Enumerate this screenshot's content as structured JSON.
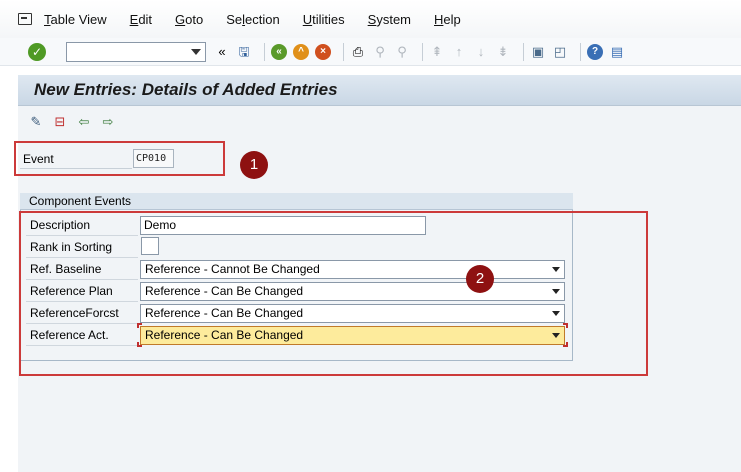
{
  "menu": {
    "items": [
      {
        "label": "Table View",
        "underline": "T"
      },
      {
        "label": "Edit",
        "underline": "E"
      },
      {
        "label": "Goto",
        "underline": "G"
      },
      {
        "label": "Selection",
        "underline": "l"
      },
      {
        "label": "Utilities",
        "underline": "U"
      },
      {
        "label": "System",
        "underline": "S"
      },
      {
        "label": "Help",
        "underline": "H"
      }
    ]
  },
  "window": {
    "title": "New Entries: Details of Added Entries"
  },
  "event": {
    "label": "Event",
    "value": "CP010"
  },
  "component_events": {
    "title": "Component Events",
    "fields": {
      "description": {
        "label": "Description",
        "value": "Demo"
      },
      "rank_in_sorting": {
        "label": "Rank in Sorting",
        "value": ""
      },
      "ref_baseline": {
        "label": "Ref. Baseline",
        "value": "Reference - Cannot Be Changed"
      },
      "reference_plan": {
        "label": "Reference Plan",
        "value": "Reference - Can Be Changed"
      },
      "reference_forcst": {
        "label": "ReferenceForcst",
        "value": "Reference - Can Be Changed"
      },
      "reference_act": {
        "label": "Reference Act.",
        "value": "Reference - Can Be Changed"
      }
    }
  },
  "annotations": {
    "badge1": "1",
    "badge2": "2"
  },
  "colors": {
    "highlight_red": "#cc3a3a",
    "badge": "#8e1111",
    "active_field": "#fdeb9c",
    "title_bar": "#c9d7e5"
  }
}
